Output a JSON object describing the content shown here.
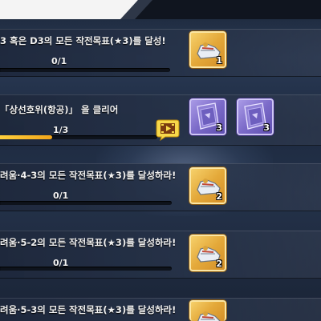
{
  "missions": [
    {
      "title": "3 혹은 D3의 모든 작전목표(★3)를 달성!",
      "progress": "0/1",
      "progress_fraction": 0,
      "rewards": [
        {
          "type": "gold",
          "icon": "shoe-gear-icon",
          "count": "1"
        }
      ]
    },
    {
      "title": "「상선호위(항공)」 을 클리어",
      "progress": "1/3",
      "progress_fraction": 0.33,
      "video_icon": "video-play-icon",
      "rewards": [
        {
          "type": "purple",
          "icon": "blueprint-book-icon",
          "count": "3"
        },
        {
          "type": "purple",
          "icon": "blueprint-book-icon",
          "count": "3"
        }
      ]
    },
    {
      "title": "려움·4-3의 모든 작전목표(★3)를 달성하라!",
      "progress": "0/1",
      "progress_fraction": 0,
      "rewards": [
        {
          "type": "gold",
          "icon": "shoe-gear-icon",
          "count": "2"
        }
      ]
    },
    {
      "title": "려움·5-2의 모든 작전목표(★3)를 달성하라!",
      "progress": "0/1",
      "progress_fraction": 0,
      "rewards": [
        {
          "type": "gold",
          "icon": "shoe-gear-icon",
          "count": "2"
        }
      ]
    },
    {
      "title": "려움·5-3의 모든 작전목표(★3)를 달성하라!",
      "progress": "",
      "progress_fraction": 0,
      "rewards": [
        {
          "type": "gold",
          "icon": "shoe-gear-icon",
          "count": ""
        }
      ]
    }
  ],
  "colors": {
    "progress_fill": "#f1a51a",
    "gold_frame": "#e4a93a",
    "purple_frame": "#7c6bc9"
  }
}
